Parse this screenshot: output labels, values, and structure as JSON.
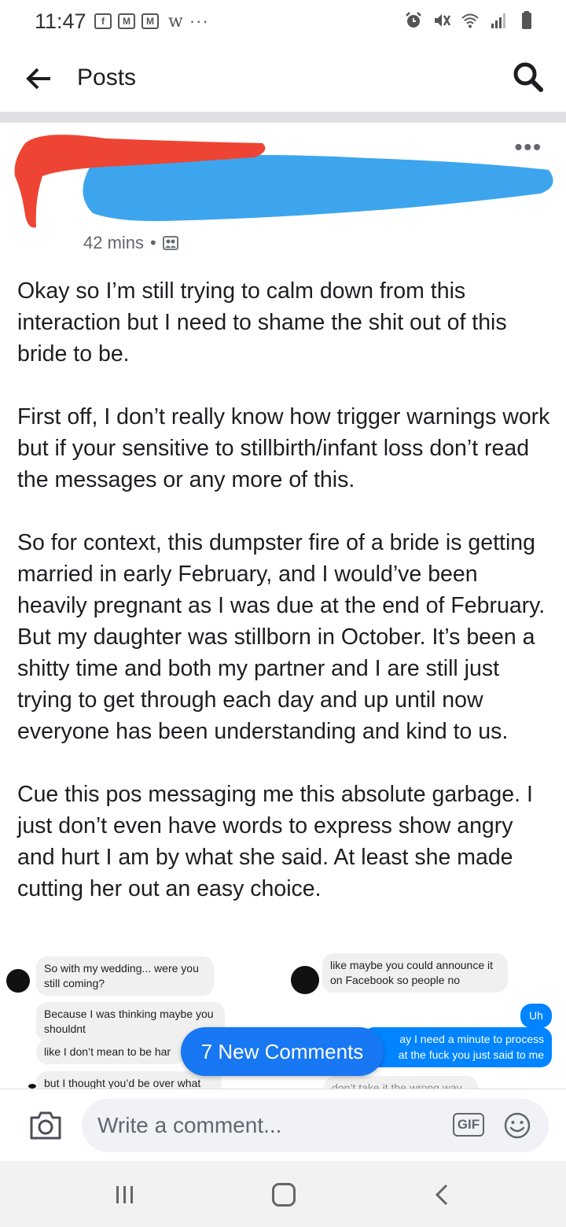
{
  "status_bar": {
    "time": "11:47",
    "notification_icons": [
      "facebook-icon",
      "gmail-icon",
      "gmail-icon",
      "wattpad-icon"
    ],
    "w_glyph": "w",
    "more": "···",
    "fb_glyph": "f",
    "mail_glyph": "M"
  },
  "header": {
    "title": "Posts"
  },
  "post": {
    "time": "42 mins",
    "separator": "•",
    "paragraphs": [
      "Okay so I’m still trying to calm down from this interaction but I need to shame the shit out of this bride to be.",
      "First off, I don’t really know how trigger warnings work but if your sensitive to stillbirth/infant loss don’t read the messages or any more of this.",
      "So for context, this dumpster fire of a bride is getting married in early February, and I would’ve been heavily pregnant as I was due at the end of February.  But my daughter was stillborn in October. It’s been a shitty time and both my partner and I are still just trying to get through each day and up until now everyone has been understanding and kind to us.",
      "Cue this pos messaging me this absolute garbage. I just don’t even have words to express show angry and hurt I am by what she said. At least she made cutting her out an easy choice."
    ]
  },
  "embedded_chat": {
    "left": [
      "So with my wedding... were you still coming?",
      "Because I was thinking maybe you shouldnt",
      "like I don’t mean to be har",
      "but I thought you’d be over what"
    ],
    "right_gray": [
      "like maybe you could announce it on Facebook so people no",
      "don’t take it the wrong way"
    ],
    "right_blue": [
      "Uh",
      "ay I need a minute to process",
      "at the fuck you just said to me"
    ]
  },
  "new_comments_label": "7 New Comments",
  "composer": {
    "placeholder": "Write a comment...",
    "gif_label": "GIF"
  },
  "colors": {
    "accent": "#1877f2",
    "messenger_blue": "#0084ff",
    "redaction_red": "#ee4433",
    "redaction_blue": "#3da5ee"
  }
}
